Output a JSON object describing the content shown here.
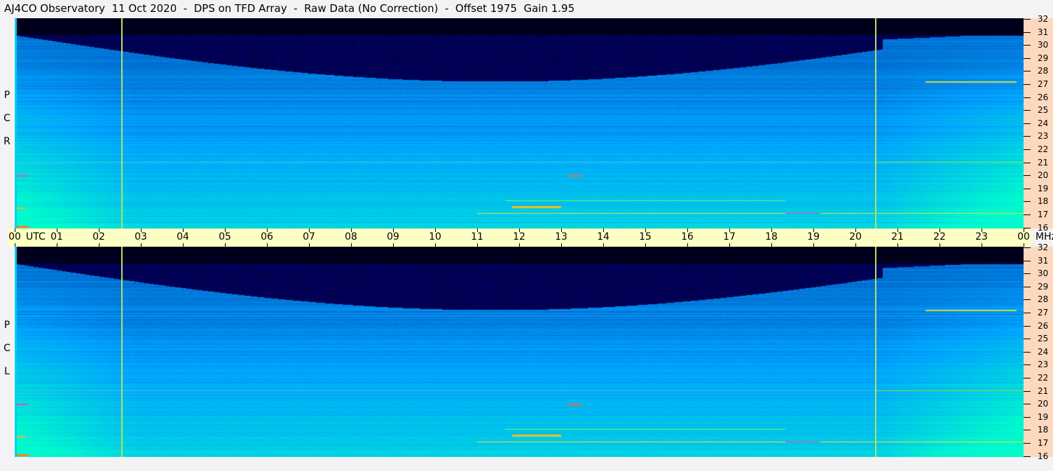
{
  "title": "AJ4CO Observatory  11 Oct 2020  -  DPS on TFD Array  -  Raw Data (No Correction)  -  Offset 1975  Gain 1.95",
  "panels": [
    {
      "label": [
        "R",
        "C",
        "P"
      ],
      "name": "RCP"
    },
    {
      "label": [
        "L",
        "C",
        "P"
      ],
      "name": "LCP"
    }
  ],
  "time_axis": {
    "labels": [
      "00",
      "01",
      "02",
      "03",
      "04",
      "05",
      "06",
      "07",
      "08",
      "09",
      "10",
      "11",
      "12",
      "13",
      "14",
      "15",
      "16",
      "17",
      "18",
      "19",
      "20",
      "21",
      "22",
      "23",
      "00"
    ],
    "utc_label": "UTC"
  },
  "freq_axis": {
    "unit": "MHz",
    "labels": [
      "32",
      "31",
      "30",
      "29",
      "28",
      "27",
      "26",
      "25",
      "24",
      "23",
      "22",
      "21",
      "20",
      "19",
      "18",
      "17",
      "16"
    ]
  },
  "markers_utc_hours": [
    2.55,
    20.48
  ],
  "colors": {
    "background": "#f3f3f5",
    "time_axis": "#ffffc4",
    "freq_axis": "#fcd9be",
    "marker": "#b4e060"
  }
}
